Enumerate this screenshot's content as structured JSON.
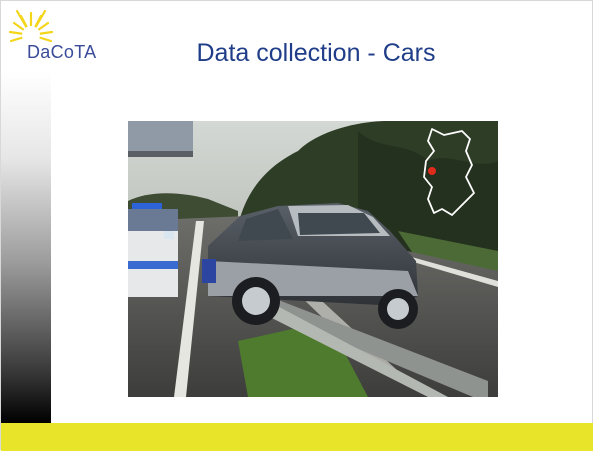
{
  "logo": {
    "text": "DaCoTA",
    "icon": "sun-icon"
  },
  "title": "Data collection - Cars",
  "colors": {
    "title": "#1f3d88",
    "logo_text": "#3a4b9a",
    "bottom_bar": "#e8e42a",
    "logo_sun": "#f3d51a"
  },
  "photo": {
    "subject": "car-on-guardrail-photo",
    "inset": "germany-map-icon"
  }
}
